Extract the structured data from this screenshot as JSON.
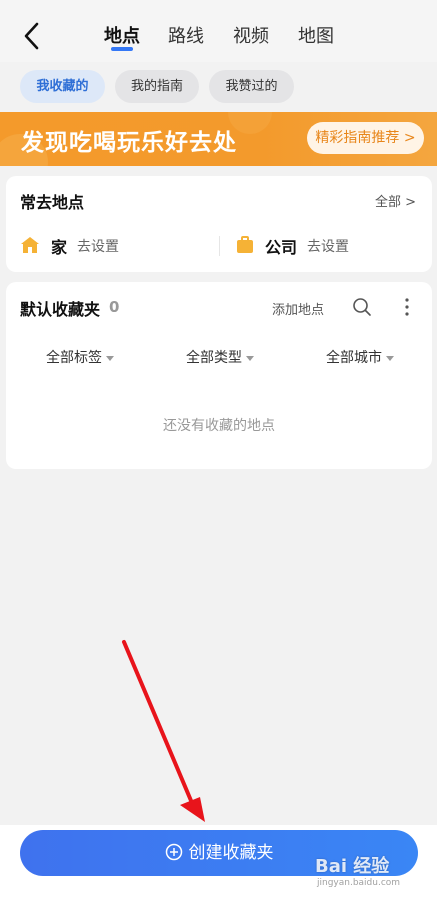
{
  "tabs": [
    {
      "label": "地点",
      "active": true
    },
    {
      "label": "路线",
      "active": false
    },
    {
      "label": "视频",
      "active": false
    },
    {
      "label": "地图",
      "active": false
    }
  ],
  "chips": [
    {
      "label": "我收藏的",
      "active": true
    },
    {
      "label": "我的指南",
      "active": false
    },
    {
      "label": "我赞过的",
      "active": false
    }
  ],
  "banner": {
    "title": "发现吃喝玩乐好去处",
    "button": "精彩指南推荐 >"
  },
  "frequent": {
    "title": "常去地点",
    "all_label": "全部 >",
    "home": {
      "name": "家",
      "action": "去设置"
    },
    "work": {
      "name": "公司",
      "action": "去设置"
    }
  },
  "folder": {
    "title": "默认收藏夹",
    "count": "0",
    "add_label": "添加地点",
    "filters": [
      "全部标签",
      "全部类型",
      "全部城市"
    ],
    "empty_text": "还没有收藏的地点"
  },
  "bottom": {
    "create_label": "创建收藏夹"
  },
  "watermark": {
    "text": "Bai 经验",
    "sub": "jingyan.baidu.com"
  },
  "colors": {
    "accent": "#3478f6",
    "banner": "#f49a2b",
    "annotation_arrow": "#e8141b"
  }
}
